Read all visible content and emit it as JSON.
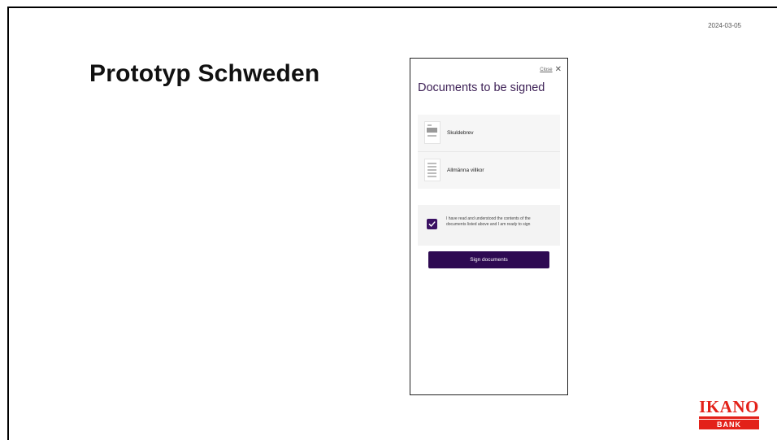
{
  "slide": {
    "date": "2024-03-05",
    "title": "Prototyp Schweden"
  },
  "modal": {
    "close_label": "Close",
    "close_icon": "close-icon",
    "title": "Documents to be signed",
    "documents": [
      {
        "name": "Skuldebrev",
        "icon": "document-thumbnail-icon"
      },
      {
        "name": "Allmänna villkor",
        "icon": "document-thumbnail-icon"
      }
    ],
    "consent": {
      "checked": true,
      "text": "I have read and understood the contents of the documents listed above and I am ready to sign"
    },
    "sign_button_label": "Sign documents"
  },
  "logo": {
    "word": "IKANO",
    "sub": "BANK",
    "color": "#e32119"
  },
  "colors": {
    "accent": "#2e0a52",
    "title_purple": "#3b1e54"
  }
}
